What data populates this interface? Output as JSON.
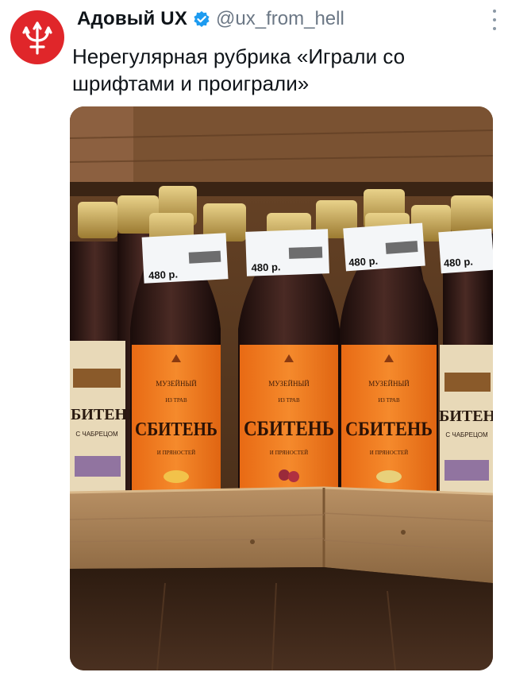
{
  "author": {
    "name": "Адовый UX",
    "handle": "@ux_from_hell",
    "avatar_icon": "trident-devil-icon",
    "verified_icon": "verified-badge-icon",
    "more_icon": "more-vertical-icon"
  },
  "tweet": {
    "text_line1": "Нерегулярная рубрика «Играли со",
    "text_line2": "шрифтами и проиграли»"
  },
  "media": {
    "price": "480 р.",
    "label_top": "МУЗЕЙНЫЙ",
    "label_sub": "ИЗ ТРАВ",
    "label_main": "СБИТЕНЬ",
    "label_bottom": "И ПРЯНОСТЕЙ",
    "side_label_main": "СБИТЕНЬ",
    "side_label_sub": "С ЧАБРЕЦОМ",
    "colors": {
      "label_orange": "#f07a1f",
      "bottle_dark": "#2a1614",
      "wood_shelf": "#a8825a",
      "wood_wall": "#5a3a22",
      "avatar_red": "#e0262a",
      "verified_blue": "#1d9bf0"
    }
  }
}
